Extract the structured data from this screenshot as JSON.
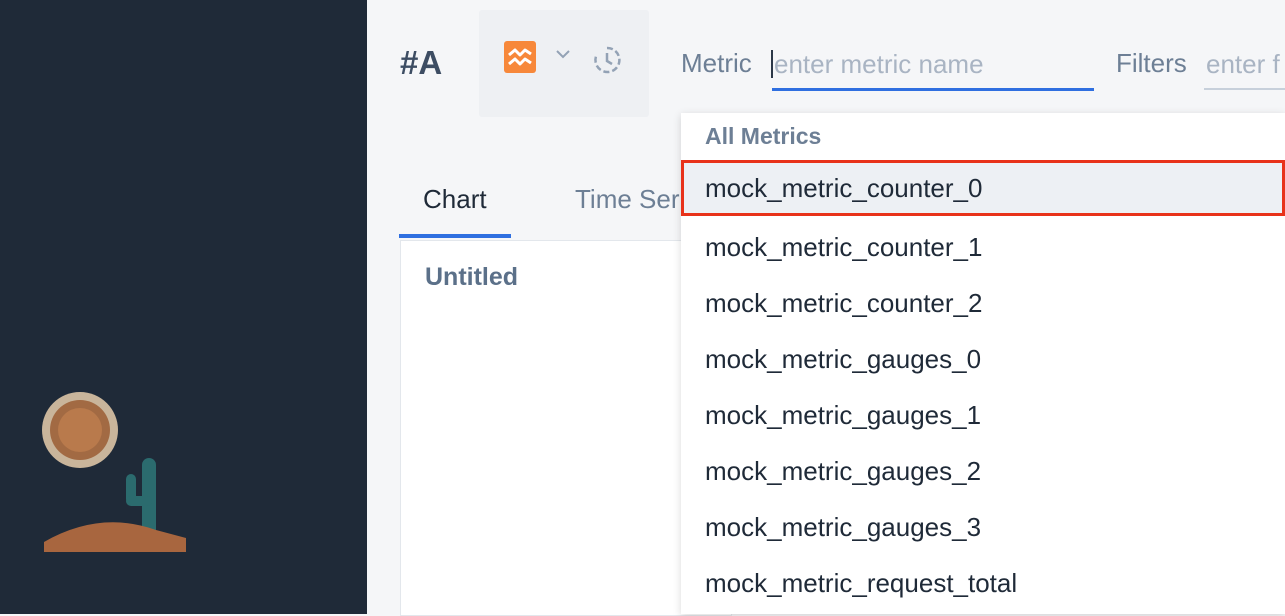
{
  "query": {
    "label": "#A"
  },
  "colors": {
    "accent": "#2f6fe0",
    "viz_icon": "#f7883a",
    "sidebar": "#1f2a38",
    "highlight_border": "#e8321a"
  },
  "icons": {
    "viz": "line-chart-icon",
    "chevron": "chevron-down-icon",
    "time": "clock-icon"
  },
  "metric": {
    "label": "Metric",
    "placeholder": "enter metric name",
    "value": ""
  },
  "filters": {
    "label": "Filters",
    "placeholder": "enter f"
  },
  "tabs": [
    {
      "label": "Chart"
    },
    {
      "label": "Time Ser"
    }
  ],
  "panel": {
    "title": "Untitled"
  },
  "dropdown": {
    "header": "All Metrics",
    "options": [
      "mock_metric_counter_0",
      "mock_metric_counter_1",
      "mock_metric_counter_2",
      "mock_metric_gauges_0",
      "mock_metric_gauges_1",
      "mock_metric_gauges_2",
      "mock_metric_gauges_3",
      "mock_metric_request_total"
    ],
    "highlighted_index": 0
  }
}
